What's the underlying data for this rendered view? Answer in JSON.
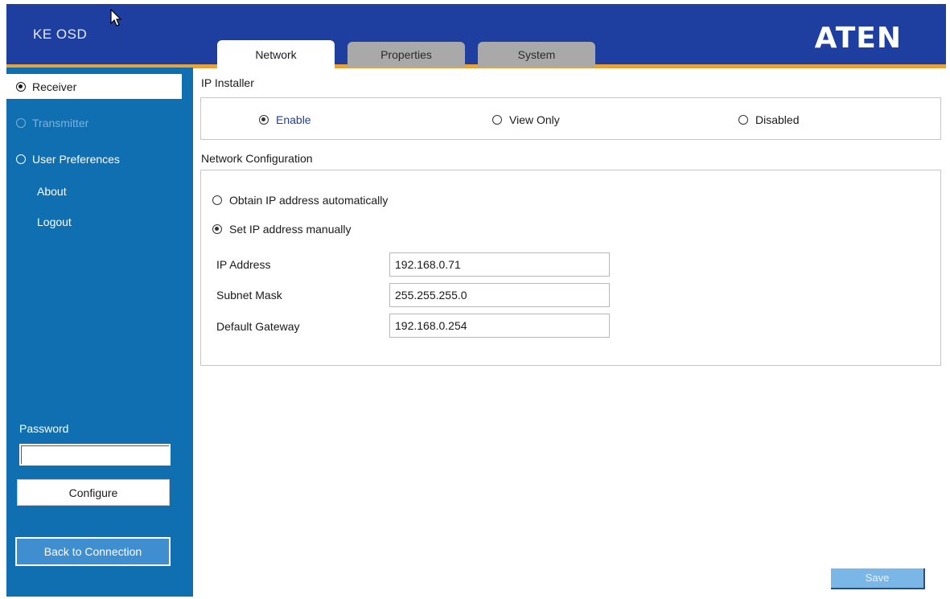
{
  "header": {
    "app_title": "KE OSD",
    "logo_text": "ATEN",
    "colors": {
      "header_bg": "#1e3ea0",
      "accent": "#e8a23a",
      "sidebar_bg": "#0f6fb0"
    }
  },
  "tabs": [
    {
      "label": "Network",
      "active": true
    },
    {
      "label": "Properties",
      "active": false
    },
    {
      "label": "System",
      "active": false
    }
  ],
  "sidebar": {
    "items": [
      {
        "label": "Receiver",
        "selected": true,
        "enabled": true
      },
      {
        "label": "Transmitter",
        "selected": false,
        "enabled": false
      },
      {
        "label": "User Preferences",
        "selected": false,
        "enabled": true
      }
    ],
    "links": [
      {
        "label": "About"
      },
      {
        "label": "Logout"
      }
    ],
    "password_label": "Password",
    "password_value": "",
    "configure_label": "Configure",
    "back_label": "Back to Connection"
  },
  "ip_installer": {
    "title": "IP Installer",
    "options": [
      {
        "label": "Enable",
        "checked": true
      },
      {
        "label": "View Only",
        "checked": false
      },
      {
        "label": "Disabled",
        "checked": false
      }
    ]
  },
  "network_config": {
    "title": "Network Configuration",
    "mode_options": [
      {
        "label": "Obtain IP address automatically",
        "checked": false
      },
      {
        "label": "Set IP address manually",
        "checked": true
      }
    ],
    "fields": [
      {
        "label": "IP Address",
        "value": "192.168.0.71"
      },
      {
        "label": "Subnet Mask",
        "value": "255.255.255.0"
      },
      {
        "label": "Default Gateway",
        "value": "192.168.0.254"
      }
    ]
  },
  "save_label": "Save"
}
